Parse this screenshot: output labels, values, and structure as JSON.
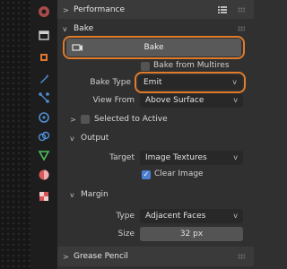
{
  "panels": {
    "performance": {
      "title": "Performance"
    },
    "bake": {
      "title": "Bake",
      "bake_button": "Bake",
      "from_multires": "Bake from Multires",
      "bake_type_label": "Bake Type",
      "bake_type_value": "Emit",
      "view_from_label": "View From",
      "view_from_value": "Above Surface",
      "selected_to_active": "Selected to Active",
      "output": {
        "title": "Output",
        "target_label": "Target",
        "target_value": "Image Textures",
        "clear_image": "Clear Image"
      },
      "margin": {
        "title": "Margin",
        "type_label": "Type",
        "type_value": "Adjacent Faces",
        "size_label": "Size",
        "size_value": "32 px"
      }
    },
    "grease_pencil": {
      "title": "Grease Pencil"
    }
  },
  "colors": {
    "highlight": "#e07b2a",
    "checkbox_on": "#4c7fd1"
  }
}
